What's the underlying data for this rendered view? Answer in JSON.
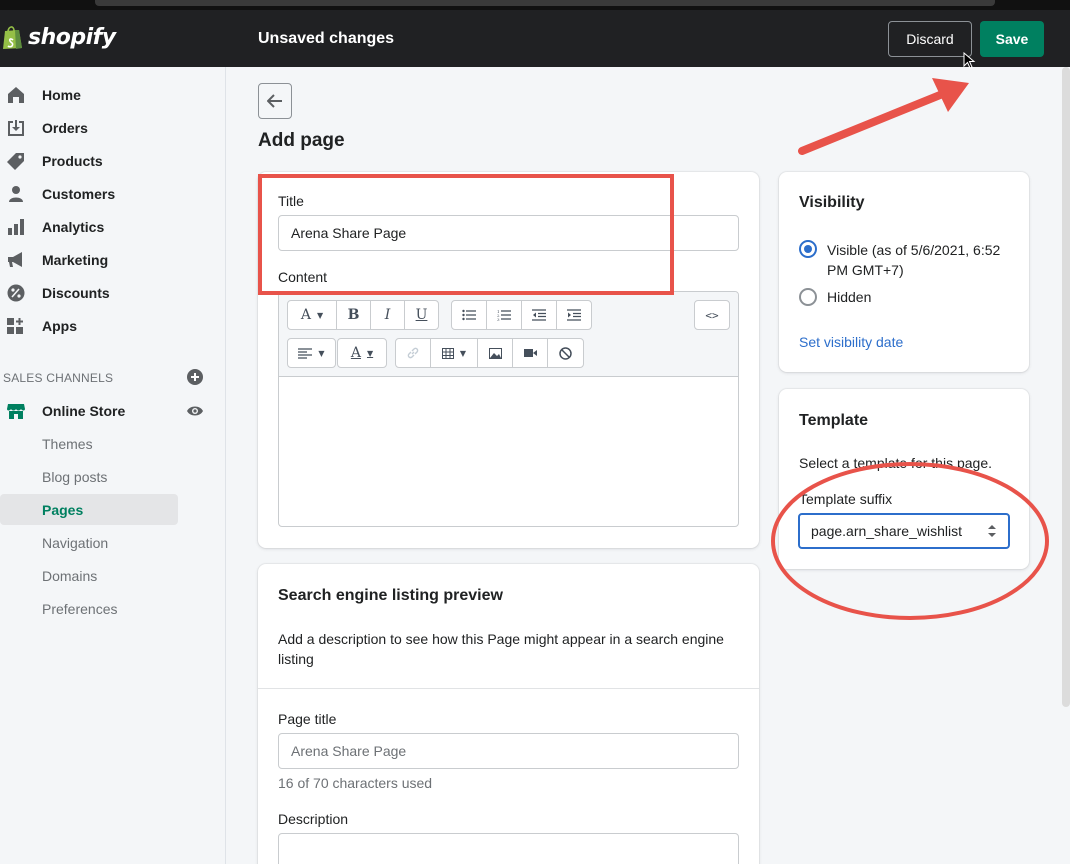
{
  "topbar": {
    "logo_text": "shopify",
    "unsaved_label": "Unsaved changes",
    "discard_label": "Discard",
    "save_label": "Save",
    "save_color": "#008060"
  },
  "sidebar": {
    "items": [
      {
        "label": "Home",
        "icon": "home-icon"
      },
      {
        "label": "Orders",
        "icon": "orders-icon"
      },
      {
        "label": "Products",
        "icon": "tag-icon"
      },
      {
        "label": "Customers",
        "icon": "person-icon"
      },
      {
        "label": "Analytics",
        "icon": "bar-chart-icon"
      },
      {
        "label": "Marketing",
        "icon": "megaphone-icon"
      },
      {
        "label": "Discounts",
        "icon": "discount-icon"
      },
      {
        "label": "Apps",
        "icon": "apps-icon"
      }
    ],
    "sales_channels_heading": "SALES CHANNELS",
    "online_store_label": "Online Store",
    "sub_items": [
      {
        "label": "Themes"
      },
      {
        "label": "Blog posts"
      },
      {
        "label": "Pages",
        "active": true
      },
      {
        "label": "Navigation"
      },
      {
        "label": "Domains"
      },
      {
        "label": "Preferences"
      }
    ]
  },
  "main": {
    "page_title": "Add page",
    "title_label": "Title",
    "title_value": "Arena Share Page",
    "content_label": "Content",
    "toolbar": {
      "row1": [
        "A",
        "B",
        "I",
        "U"
      ],
      "html_button": "<>",
      "row2_color_letter": "A"
    },
    "seo": {
      "heading": "Search engine listing preview",
      "description": "Add a description to see how this Page might appear in a search engine listing",
      "page_title_label": "Page title",
      "page_title_placeholder": "Arena Share Page",
      "char_count": "16 of 70 characters used",
      "description_label": "Description"
    }
  },
  "visibility": {
    "heading": "Visibility",
    "visible_label": "Visible (as of 5/6/2021, 6:52 PM GMT+7)",
    "hidden_label": "Hidden",
    "set_date_link": "Set visibility date",
    "selected": "visible"
  },
  "template": {
    "heading": "Template",
    "description": "Select a template for this page.",
    "suffix_label": "Template suffix",
    "suffix_value": "page.arn_share_wishlist"
  },
  "annotations": {
    "color": "#e8534a"
  }
}
